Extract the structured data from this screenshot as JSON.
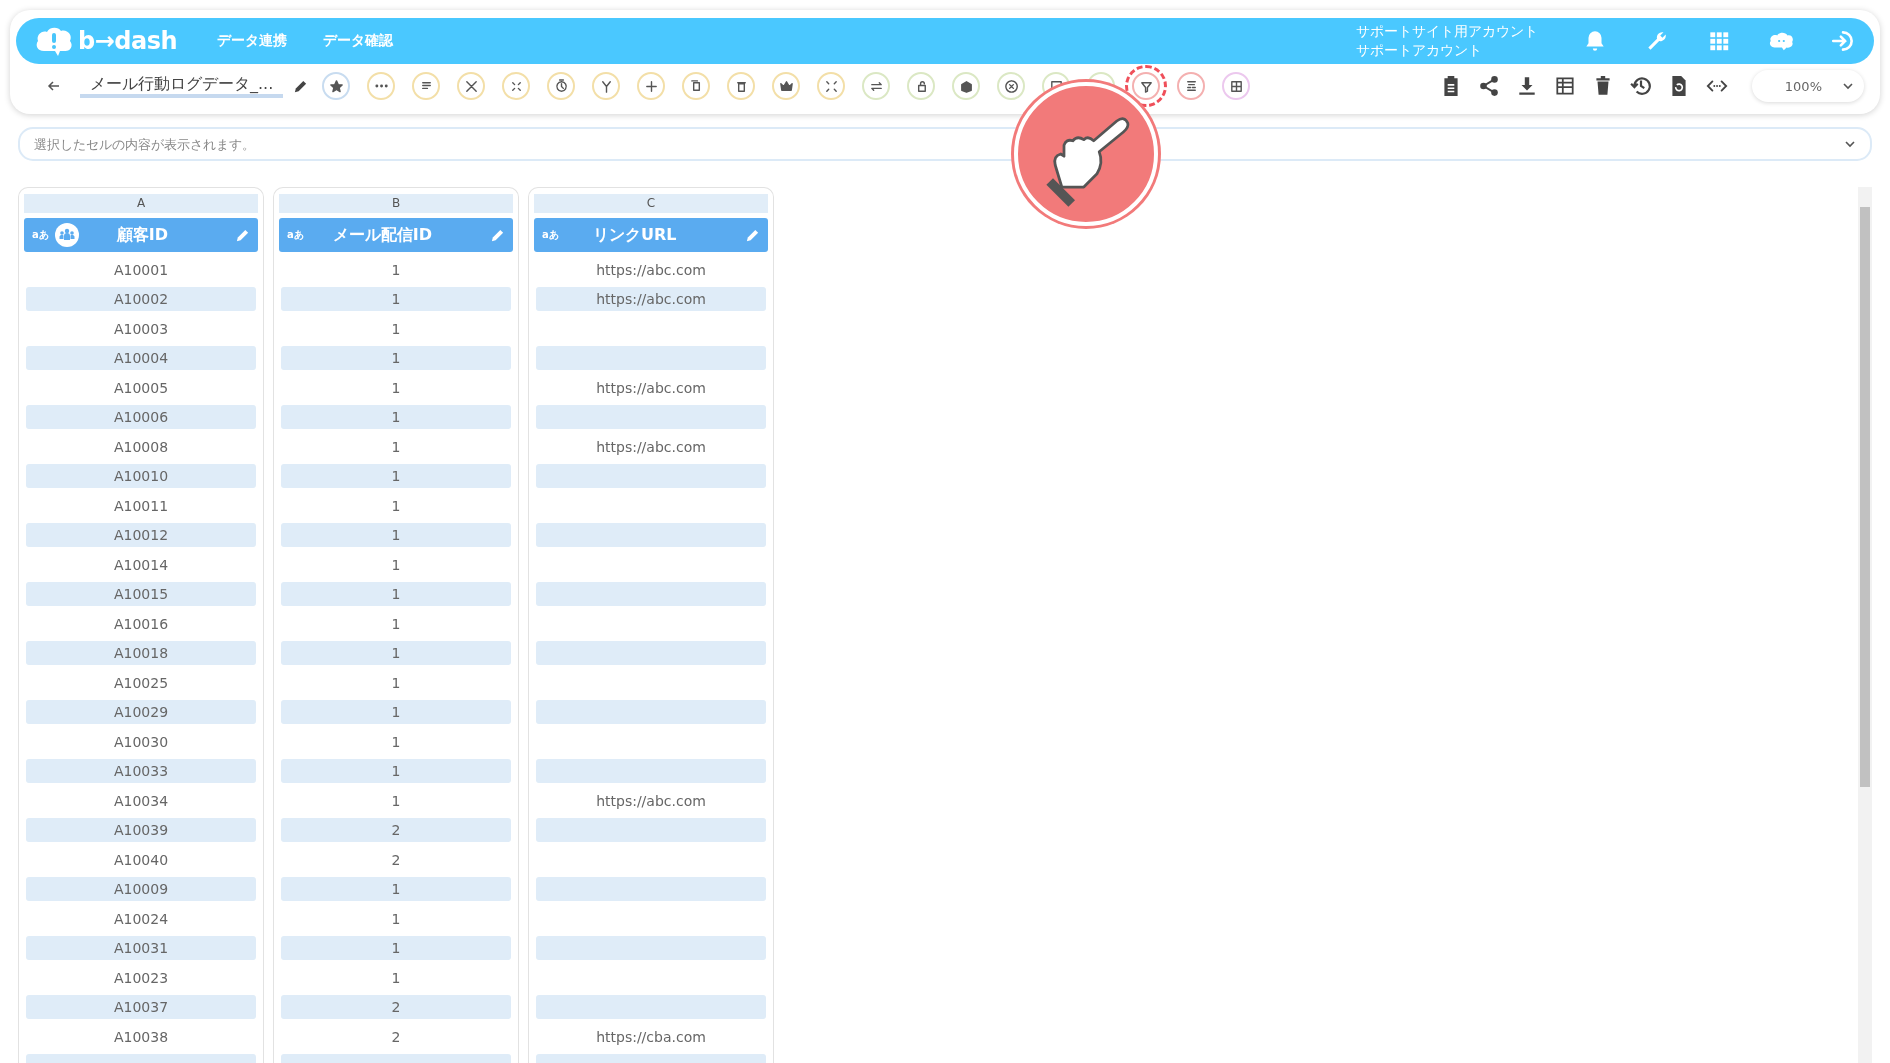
{
  "header": {
    "logo": "b→dash",
    "nav": [
      "データ連携",
      "データ確認"
    ],
    "account": [
      "サポートサイト用アカウント",
      "サポートアカウント"
    ]
  },
  "toolbar": {
    "title": "メール行動ログデータ_...",
    "tools": [
      {
        "color": "#c8dcf0",
        "highlighted": false
      },
      {
        "color": "#f3dfa8",
        "highlighted": false
      },
      {
        "color": "#f3dfa8",
        "highlighted": false
      },
      {
        "color": "#f3dfa8",
        "highlighted": false
      },
      {
        "color": "#f3dfa8",
        "highlighted": false
      },
      {
        "color": "#f3dfa8",
        "highlighted": false
      },
      {
        "color": "#f3dfa8",
        "highlighted": false
      },
      {
        "color": "#f3dfa8",
        "highlighted": false
      },
      {
        "color": "#f3dfa8",
        "highlighted": false
      },
      {
        "color": "#f3dfa8",
        "highlighted": false
      },
      {
        "color": "#f3dfa8",
        "highlighted": false
      },
      {
        "color": "#f3dfa8",
        "highlighted": false
      },
      {
        "color": "#dbe8c4",
        "highlighted": false
      },
      {
        "color": "#dbe8c4",
        "highlighted": false
      },
      {
        "color": "#dbe8c4",
        "highlighted": false
      },
      {
        "color": "#dbe8c4",
        "highlighted": false
      },
      {
        "color": "#dbe8c4",
        "highlighted": false
      },
      {
        "color": "#dbe8c4",
        "highlighted": false
      },
      {
        "color": "#f4b0b0",
        "highlighted": true
      },
      {
        "color": "#f4b0b0",
        "highlighted": false
      },
      {
        "color": "#ecc8ee",
        "highlighted": false
      }
    ],
    "zoom": "100%"
  },
  "cell_preview": {
    "placeholder": "選択したセルの内容が表示されます。"
  },
  "columns": [
    {
      "letter": "A",
      "type": "aあ",
      "name": "顧客ID",
      "customer_key": true
    },
    {
      "letter": "B",
      "type": "aあ",
      "name": "メール配信ID",
      "customer_key": false
    },
    {
      "letter": "C",
      "type": "aあ",
      "name": "リンクURL",
      "customer_key": false
    }
  ],
  "rows": [
    [
      "A10001",
      "1",
      "https://abc.com"
    ],
    [
      "A10002",
      "1",
      "https://abc.com"
    ],
    [
      "A10003",
      "1"
    ],
    [
      "A10004",
      "1"
    ],
    [
      "A10005",
      "1",
      "https://abc.com"
    ],
    [
      "A10006",
      "1"
    ],
    [
      "A10008",
      "1",
      "https://abc.com"
    ],
    [
      "A10010",
      "1"
    ],
    [
      "A10011",
      "1"
    ],
    [
      "A10012",
      "1"
    ],
    [
      "A10014",
      "1"
    ],
    [
      "A10015",
      "1"
    ],
    [
      "A10016",
      "1"
    ],
    [
      "A10018",
      "1"
    ],
    [
      "A10025",
      "1"
    ],
    [
      "A10029",
      "1"
    ],
    [
      "A10030",
      "1"
    ],
    [
      "A10033",
      "1"
    ],
    [
      "A10034",
      "1",
      "https://abc.com"
    ],
    [
      "A10039",
      "2"
    ],
    [
      "A10040",
      "2"
    ],
    [
      "A10009",
      "1"
    ],
    [
      "A10024",
      "1"
    ],
    [
      "A10031",
      "1"
    ],
    [
      "A10023",
      "1"
    ],
    [
      "A10037",
      "2"
    ],
    [
      "A10038",
      "2",
      "https://cba.com"
    ]
  ]
}
